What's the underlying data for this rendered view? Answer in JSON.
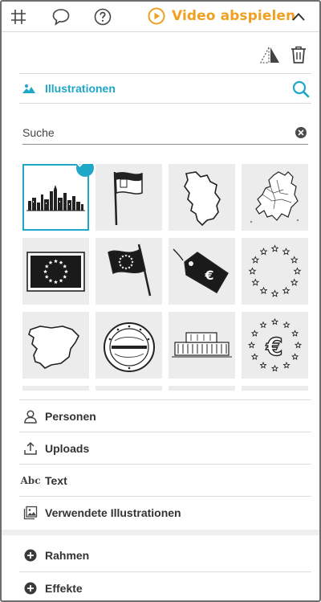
{
  "toolbar": {
    "grid_icon": "grid-icon",
    "comment_icon": "comment-icon",
    "help_icon": "help-icon",
    "video_label": "Video abspielen",
    "collapse_icon": "chevron-up-icon"
  },
  "tools": {
    "flip_icon": "flip-icon",
    "trash_icon": "trash-icon"
  },
  "illustrations": {
    "title": "Illustrationen",
    "search_placeholder": "Suche"
  },
  "grid_items": [
    {
      "name": "skyline",
      "selected": true
    },
    {
      "name": "serbia-flag"
    },
    {
      "name": "serbia-map"
    },
    {
      "name": "europe-map"
    },
    {
      "name": "eu-flag"
    },
    {
      "name": "eu-flag-waving"
    },
    {
      "name": "euro-price-tag"
    },
    {
      "name": "eu-stars-circle"
    },
    {
      "name": "spain-map"
    },
    {
      "name": "euro-coin"
    },
    {
      "name": "building"
    },
    {
      "name": "euro-stars"
    }
  ],
  "menu": {
    "personen": "Personen",
    "uploads": "Uploads",
    "text": "Text",
    "text_icon": "Abc",
    "verwendete": "Verwendete Illustrationen",
    "rahmen": "Rahmen",
    "effekte": "Effekte"
  },
  "colors": {
    "accent": "#1fa7c7",
    "video": "#f0a020"
  }
}
